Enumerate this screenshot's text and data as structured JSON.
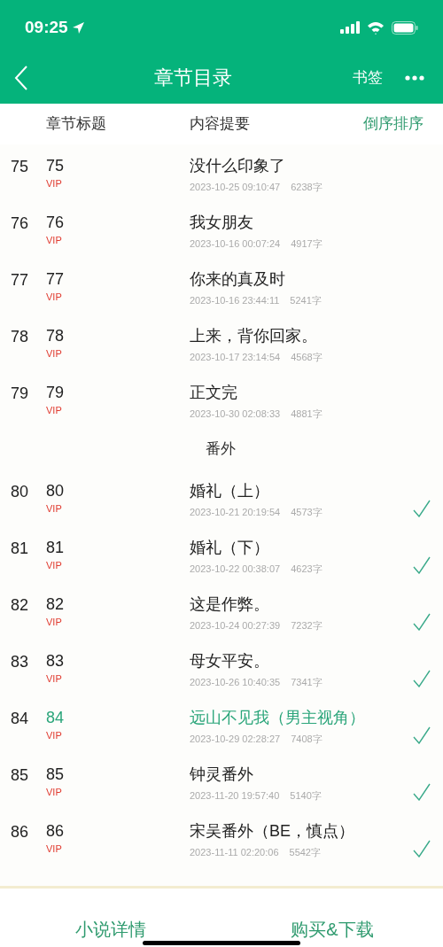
{
  "status_bar": {
    "time": "09:25"
  },
  "nav": {
    "title": "章节目录",
    "bookmark": "书签"
  },
  "header": {
    "column_1": "章节标题",
    "column_2": "内容提要",
    "sort": "倒序排序"
  },
  "sections": [
    {
      "chapters": [
        {
          "index": "75",
          "number": "75",
          "tag": "VIP",
          "title": "没什么印象了",
          "date": "2023-10-25 09:10:47",
          "words": "6238字",
          "selected": false,
          "downloaded": false
        },
        {
          "index": "76",
          "number": "76",
          "tag": "VIP",
          "title": "我女朋友",
          "date": "2023-10-16 00:07:24",
          "words": "4917字",
          "selected": false,
          "downloaded": false
        },
        {
          "index": "77",
          "number": "77",
          "tag": "VIP",
          "title": "你来的真及时",
          "date": "2023-10-16 23:44:11",
          "words": "5241字",
          "selected": false,
          "downloaded": false
        },
        {
          "index": "78",
          "number": "78",
          "tag": "VIP",
          "title": "上来，背你回家。",
          "date": "2023-10-17 23:14:54",
          "words": "4568字",
          "selected": false,
          "downloaded": false
        },
        {
          "index": "79",
          "number": "79",
          "tag": "VIP",
          "title": "正文完",
          "date": "2023-10-30 02:08:33",
          "words": "4881字",
          "selected": false,
          "downloaded": false
        }
      ]
    },
    {
      "heading": "番外",
      "chapters": [
        {
          "index": "80",
          "number": "80",
          "tag": "VIP",
          "title": "婚礼（上）",
          "date": "2023-10-21 20:19:54",
          "words": "4573字",
          "selected": false,
          "downloaded": true
        },
        {
          "index": "81",
          "number": "81",
          "tag": "VIP",
          "title": "婚礼（下）",
          "date": "2023-10-22 00:38:07",
          "words": "4623字",
          "selected": false,
          "downloaded": true
        },
        {
          "index": "82",
          "number": "82",
          "tag": "VIP",
          "title": "这是作弊。",
          "date": "2023-10-24 00:27:39",
          "words": "7232字",
          "selected": false,
          "downloaded": true
        },
        {
          "index": "83",
          "number": "83",
          "tag": "VIP",
          "title": "母女平安。",
          "date": "2023-10-26 10:40:35",
          "words": "7341字",
          "selected": false,
          "downloaded": true
        },
        {
          "index": "84",
          "number": "84",
          "tag": "VIP",
          "title": "远山不见我（男主视角）",
          "date": "2023-10-29 02:28:27",
          "words": "7408字",
          "selected": true,
          "downloaded": true
        },
        {
          "index": "85",
          "number": "85",
          "tag": "VIP",
          "title": "钟灵番外",
          "date": "2023-11-20 19:57:40",
          "words": "5140字",
          "selected": false,
          "downloaded": true
        },
        {
          "index": "86",
          "number": "86",
          "tag": "VIP",
          "title": "宋吴番外（BE，慎点）",
          "date": "2023-11-11 02:20:06",
          "words": "5542字",
          "selected": false,
          "downloaded": true
        }
      ]
    }
  ],
  "footer": {
    "details": "小说详情",
    "buy": "购买&下载"
  }
}
